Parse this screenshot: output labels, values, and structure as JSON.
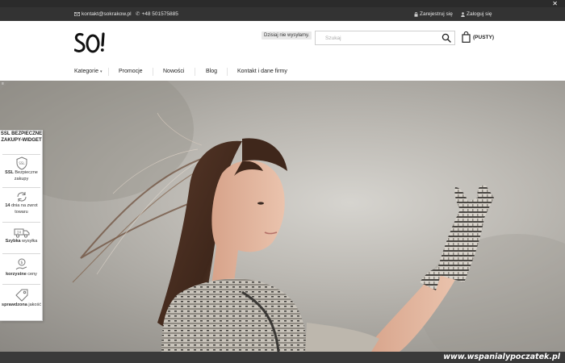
{
  "topbar": {
    "close_glyph": "✕",
    "close_icon": "close-icon"
  },
  "contact": {
    "email": "kontakt@sokrakow.pl",
    "phone": "+48 501575885",
    "register": "Zarejestruj się",
    "login": "Zaloguj się",
    "icons": [
      "envelope-icon",
      "phone-icon",
      "lock-icon",
      "user-icon"
    ]
  },
  "header": {
    "logo_text": "SO!",
    "shipping": "Dzisiaj nie wysyłamy.",
    "search_placeholder": "Szukaj",
    "cart_label": "(PUSTY)"
  },
  "nav": {
    "items": [
      "Kategorie",
      "Promocje",
      "Nowości",
      "Blog",
      "Kontakt i dane firmy"
    ]
  },
  "ssl_widget": {
    "title": "SSL BEZPIECZNE ZAKUPY-WIDGET",
    "items": [
      {
        "bold": "SSL",
        "text": "Bezpieczne zakupy",
        "icon": "shield-ssl-icon"
      },
      {
        "bold": "14",
        "text": "dnia na zwrot towaru",
        "icon": "return-arrows-icon"
      },
      {
        "bold": "Szybka",
        "text": "wysyłka",
        "icon": "delivery-truck-icon"
      },
      {
        "bold": "korzystne",
        "text": "ceny",
        "icon": "price-coin-icon"
      },
      {
        "bold": "sprawdzona",
        "text": "jakość",
        "icon": "price-tag-icon"
      }
    ]
  },
  "watermark": "www.wspanialypoczatek.pl",
  "colors": {
    "topbar": "#2b2b2b",
    "contactbar": "#333333",
    "accent": "#222222"
  }
}
